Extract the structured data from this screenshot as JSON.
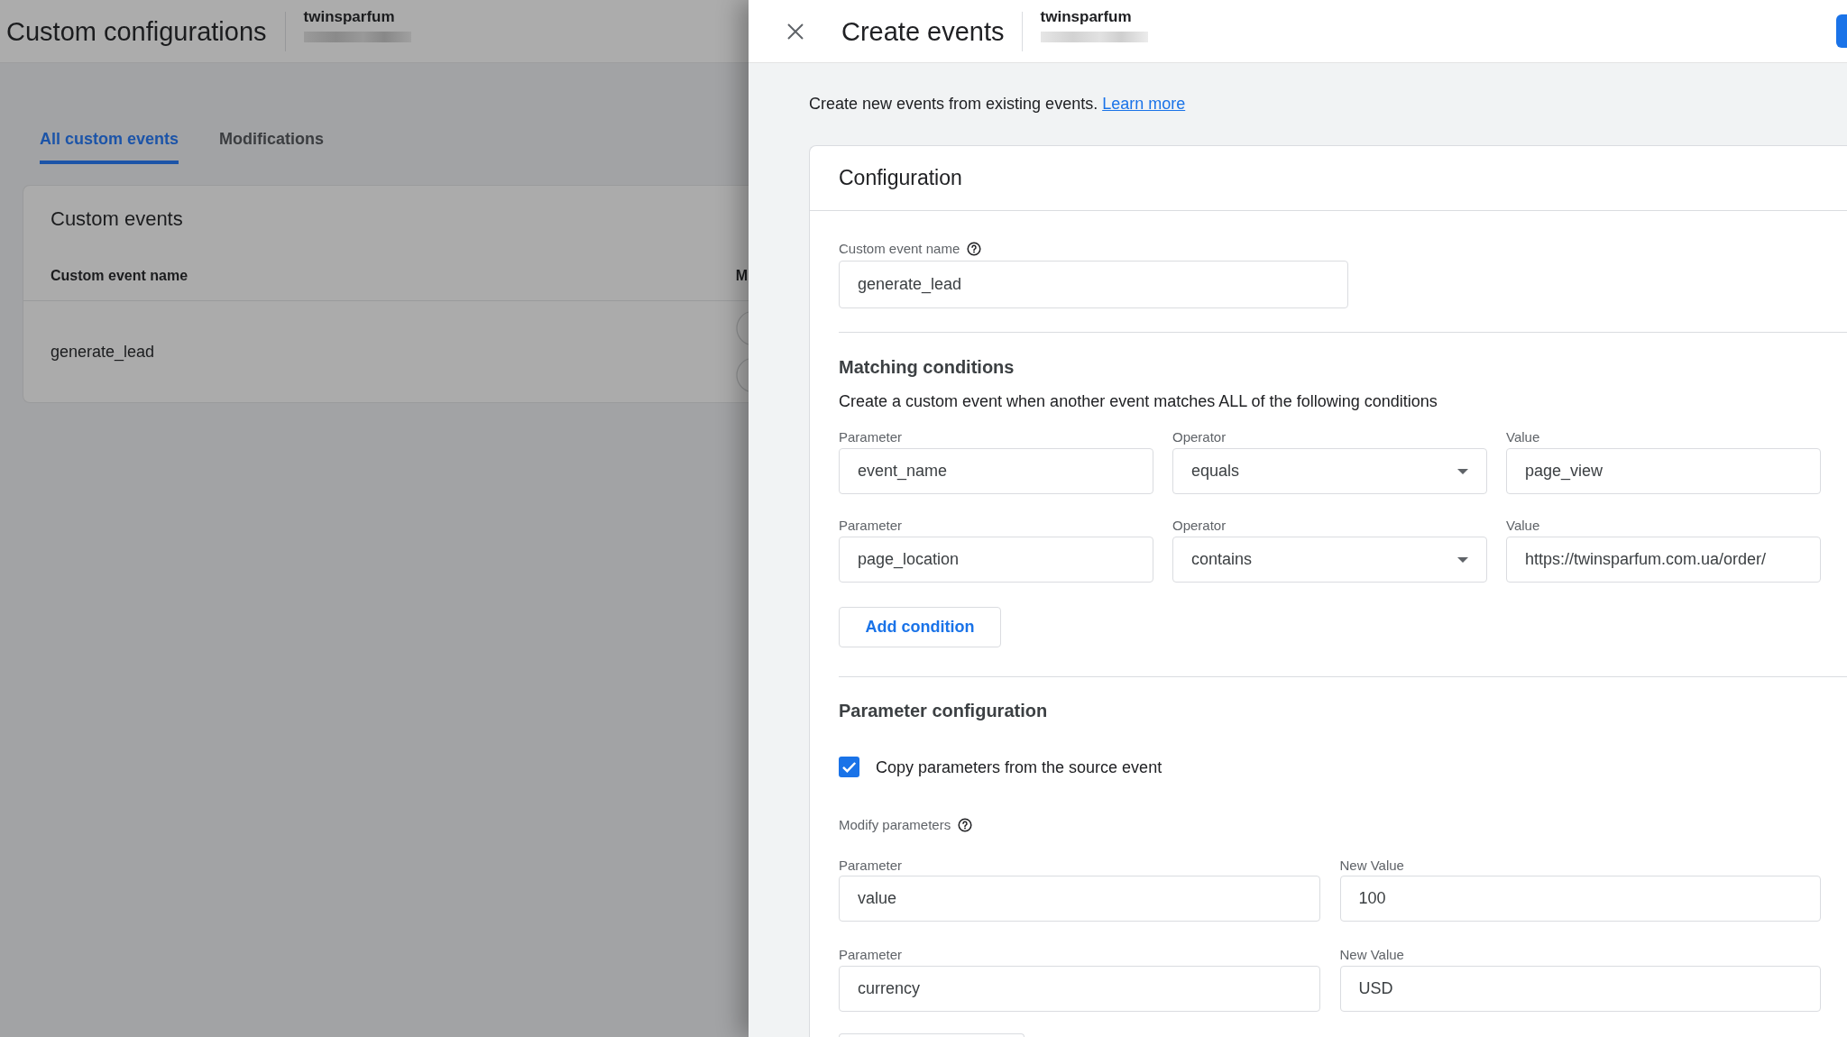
{
  "background_page": {
    "header": {
      "title": "Custom configurations",
      "account": "twinsparfum"
    },
    "tabs": [
      {
        "label": "All custom events",
        "selected": true
      },
      {
        "label": "Modifications",
        "selected": false
      }
    ],
    "custom_events_card": {
      "title": "Custom events",
      "columns": [
        "Custom event name",
        "M"
      ],
      "rows": [
        {
          "cells": [
            "generate_lead"
          ]
        }
      ]
    }
  },
  "panel": {
    "title": "Create events",
    "account": "twinsparfum",
    "intro": {
      "text": "Create new events from existing events.",
      "link": "Learn more"
    },
    "configuration": {
      "title": "Configuration",
      "event_name": {
        "label": "Custom event name",
        "value": "generate_lead"
      },
      "matching_conditions": {
        "title": "Matching conditions",
        "description": "Create a custom event when another event matches ALL of the following conditions",
        "conditions": [
          {
            "parameter_label": "Parameter",
            "parameter": "event_name",
            "operator_label": "Operator",
            "operator": "equals",
            "value_label": "Value",
            "value": "page_view"
          },
          {
            "parameter_label": "Parameter",
            "parameter": "page_location",
            "operator_label": "Operator",
            "operator": "contains",
            "value_label": "Value",
            "value": "https://twinsparfum.com.ua/order/"
          }
        ],
        "add_button": "Add condition"
      },
      "parameter_configuration": {
        "title": "Parameter configuration",
        "copy_parameters": {
          "label": "Copy parameters from the source event",
          "checked": true
        },
        "modify_label": "Modify parameters",
        "modifications": [
          {
            "parameter_label": "Parameter",
            "parameter": "value",
            "new_value_label": "New Value",
            "new_value": "100"
          },
          {
            "parameter_label": "Parameter",
            "parameter": "currency",
            "new_value_label": "New Value",
            "new_value": "USD"
          }
        ]
      }
    }
  }
}
